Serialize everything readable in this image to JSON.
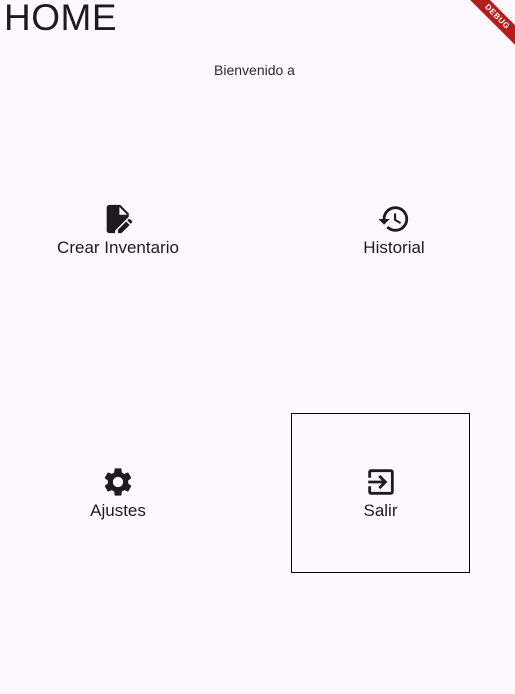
{
  "header": {
    "title": "HOME"
  },
  "welcome": {
    "text": "Bienvenido a"
  },
  "menu": {
    "crear_inventario": {
      "label": "Crear Inventario",
      "icon": "edit-document-icon"
    },
    "historial": {
      "label": "Historial",
      "icon": "history-icon"
    },
    "ajustes": {
      "label": "Ajustes",
      "icon": "gear-icon"
    },
    "salir": {
      "label": "Salir",
      "icon": "exit-icon"
    }
  },
  "debug_banner": {
    "text": "DEBUG"
  },
  "colors": {
    "background": "#fdf7fe",
    "text": "#1d1b20",
    "debug": "#b71c1c"
  }
}
